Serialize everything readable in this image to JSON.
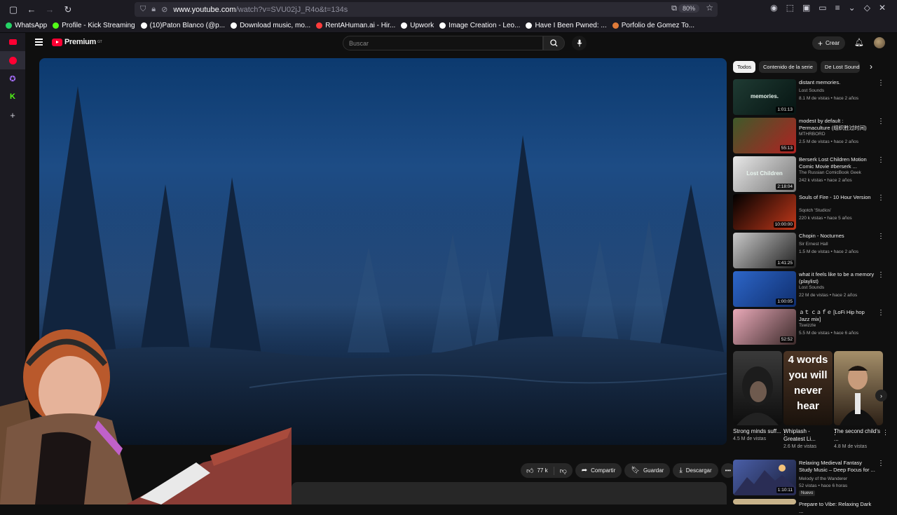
{
  "browser": {
    "url_host": "www.youtube.com",
    "url_path": "/watch?v=SVU02jJ_R4o&t=134s",
    "zoom": "80%",
    "bookmarks": [
      {
        "label": "WhatsApp",
        "icon": "whatsapp-icon",
        "color": "#25d366"
      },
      {
        "label": "Profile - Kick Streaming",
        "icon": "kick-icon",
        "color": "#53fc18"
      },
      {
        "label": "(10)Paton Blanco (@p...",
        "icon": "tiktok-icon",
        "color": "#ffffff"
      },
      {
        "label": "Download music, mo...",
        "icon": "download-site-icon",
        "color": "#ffffff"
      },
      {
        "label": "RentAHuman.ai - Hir...",
        "icon": "rentahuman-icon",
        "color": "#ff3b3b"
      },
      {
        "label": "Upwork",
        "icon": "upwork-icon",
        "color": "#ffffff"
      },
      {
        "label": "Image Creation - Leo...",
        "icon": "globe-icon",
        "color": "#ffffff"
      },
      {
        "label": "Have I Been Pwned: ...",
        "icon": "hibp-icon",
        "color": "#ffffff"
      },
      {
        "label": "Porfolio de Gomez To...",
        "icon": "portfolio-icon",
        "color": "#e07b39"
      }
    ]
  },
  "header": {
    "logo_text": "Premium",
    "logo_region": "GT",
    "search_placeholder": "Buscar",
    "create_label": "Crear"
  },
  "actions": {
    "likes": "77 k",
    "share": "Compartir",
    "save": "Guardar",
    "download": "Descargar"
  },
  "chips": [
    "Todos",
    "Contenido de la serie",
    "De Lost Sounds"
  ],
  "recommendations": [
    {
      "title": "distant memories.",
      "channel": "Lost Sounds",
      "meta": "8.1 M de vistas • hace 2 años",
      "duration": "1:01:13",
      "thumb_text": "memories.",
      "colors": [
        "#1f3b33",
        "#061412"
      ]
    },
    {
      "title": "modest by default : Permaculture (组织胜过时间)",
      "channel": "MTHRBORD",
      "meta": "2.5 M de vistas • hace 2 años",
      "duration": "55:13",
      "thumb_text": "",
      "colors": [
        "#3f5a2a",
        "#b02222"
      ]
    },
    {
      "title": "Berserk Lost Children Motion Comic Movie #berserk ...",
      "channel": "The Russian ComicBook Geek",
      "meta": "242 k vistas • hace 2 años",
      "duration": "2:18:04",
      "thumb_text": "Lost Children",
      "colors": [
        "#e8e8e8",
        "#777777"
      ]
    },
    {
      "title": "Souls of Fire - 10 Hour Version",
      "channel": "Sqotch 'Studios'",
      "meta": "220 k vistas • hace 5 años",
      "duration": "10:00:00",
      "thumb_text": "",
      "colors": [
        "#000000",
        "#c2381a"
      ]
    },
    {
      "title": "Chopin - Nocturnes",
      "channel": "Sir Ernest Hall",
      "meta": "1.5 M de vistas • hace 2 años",
      "duration": "1:41:25",
      "thumb_text": "",
      "colors": [
        "#c9c9c9",
        "#222222"
      ]
    },
    {
      "title": "what it feels like to be a memory (playlist)",
      "channel": "Lost Sounds",
      "meta": "22 M de vistas • hace 2 años",
      "duration": "1:00:05",
      "thumb_text": "",
      "colors": [
        "#2d66c8",
        "#0f2e6e"
      ]
    },
    {
      "title": "ａｔ ｃａｆｅ [LoFi Hip hop Jazz mix]",
      "channel": "Tswizzle",
      "meta": "5.5 M de vistas • hace 6 años",
      "duration": "52:52",
      "thumb_text": "",
      "colors": [
        "#e9a9b8",
        "#3b2a2a"
      ]
    }
  ],
  "shorts": [
    {
      "title": "Strong minds suff...",
      "views": "4.5 M de vistas",
      "thumb_text": "",
      "colors": [
        "#3a3a3a",
        "#0d0d0d"
      ]
    },
    {
      "title": "Whiplash - Greatest Li...",
      "views": "2.6 M de vistas",
      "thumb_text": "4 words you will never hear",
      "colors": [
        "#4b3424",
        "#1a120c"
      ]
    },
    {
      "title": "The second child's ...",
      "views": "4.8 M de vistas",
      "thumb_text": "",
      "colors": [
        "#a58f6a",
        "#2c2016"
      ]
    }
  ],
  "last_rec": {
    "title": "Relaxing Medieval Fantasy Study Music – Deep Focus for ...",
    "channel": "Melody of the Wanderer",
    "meta": "52 vistas • hace 6 horas",
    "duration": "1:10:11",
    "badge": "Nuevo",
    "colors": [
      "#4a5fa8",
      "#1b1f3a"
    ]
  },
  "partial_rec_title": "Prepare to Vibe: Relaxing Dark ..."
}
